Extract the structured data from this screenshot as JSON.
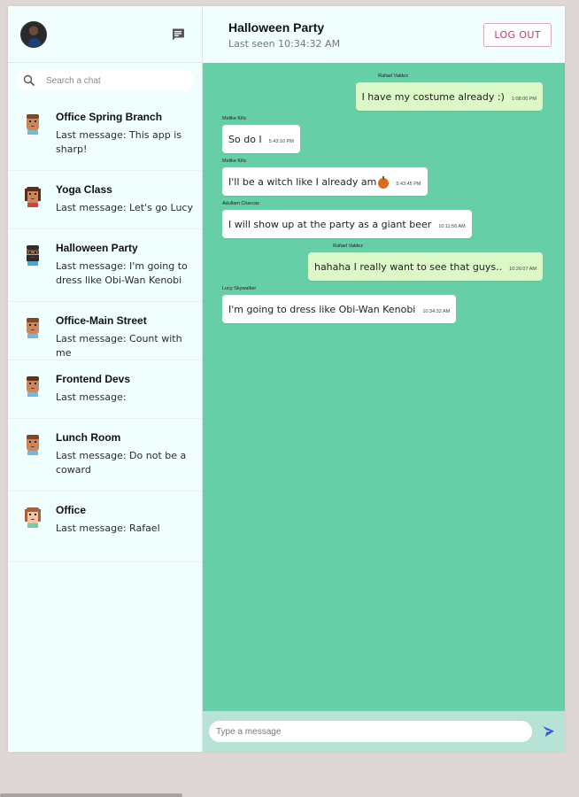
{
  "sidebar": {
    "search_placeholder": "Search a chat",
    "chats": [
      {
        "name": "Office Spring Branch",
        "last": "Last message: This app is sharp!",
        "avatar": "avatar-tan"
      },
      {
        "name": "Yoga Class",
        "last": "Last message: Let's go Lucy",
        "avatar": "avatar-dark-hair"
      },
      {
        "name": "Halloween Party",
        "last": "Last message: I'm going to dress like Obi-Wan Kenobi",
        "avatar": "avatar-bearded"
      },
      {
        "name": "Office-Main Street",
        "last": "Last message: Count with me",
        "avatar": "avatar-tan"
      },
      {
        "name": "Frontend Devs",
        "last": "Last message:",
        "avatar": "avatar-bun"
      },
      {
        "name": "Lunch Room",
        "last": "Last message: Do not be a coward",
        "avatar": "avatar-tan"
      },
      {
        "name": "Office",
        "last": "Last message: Rafael",
        "avatar": "avatar-light"
      }
    ]
  },
  "header": {
    "title": "Halloween Party",
    "subtitle": "Last seen 10:34:32 AM",
    "logout_label": "LOG OUT"
  },
  "messages": [
    {
      "author": "Rafael Valdez",
      "text": "I have my costume already :)",
      "time": "1:08:00 PM",
      "mine": true
    },
    {
      "author": "Melike Kilic",
      "text": "So do I",
      "time": "5:43:10 PM",
      "mine": false
    },
    {
      "author": "Melike Kilic",
      "text": "I'll be a witch like I already am",
      "time": "5:43:45 PM",
      "mine": false,
      "emoji": "pumpkin"
    },
    {
      "author": "Adullam Charcas",
      "text": "I will show up at the party as a giant beer",
      "time": "10:11:56 AM",
      "mine": false
    },
    {
      "author": "Rafael Valdez",
      "text": "hahaha I really want to see that guys..",
      "time": "10:26:07 AM",
      "mine": true
    },
    {
      "author": "Lucy Skywalker",
      "text": "I'm going to dress like Obi-Wan Kenobi",
      "time": "10:34:32 AM",
      "mine": false
    }
  ],
  "composer": {
    "placeholder": "Type a message"
  },
  "colors": {
    "chat_background": "#66cfa8",
    "own_bubble": "#dcf8c6",
    "other_bubble": "#ffffff",
    "logout_accent": "#c03a66",
    "send_icon": "#3b5bd0"
  }
}
